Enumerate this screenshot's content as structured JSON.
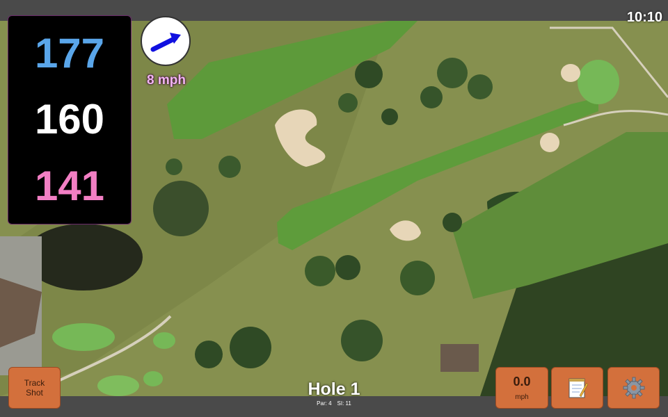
{
  "status": {
    "time": "10:10"
  },
  "distances": {
    "back": "177",
    "middle": "160",
    "front": "141"
  },
  "wind": {
    "speed": "8 mph",
    "arrow_icon": "arrow-right-icon",
    "arrow_color": "#1010e0"
  },
  "hole": {
    "title": "Hole 1",
    "par": "Par: 4",
    "stroke_index": "SI: 11"
  },
  "buttons": {
    "track_shot": "Track\nShot",
    "speed_value": "0.0",
    "speed_unit": "mph",
    "notes_icon": "notepad-icon",
    "settings_icon": "gear-icon"
  },
  "colors": {
    "back": "#5aa6ea",
    "middle": "#ffffff",
    "front": "#f27fc4",
    "button": "#d3703c",
    "bar": "#4a4a4a"
  }
}
